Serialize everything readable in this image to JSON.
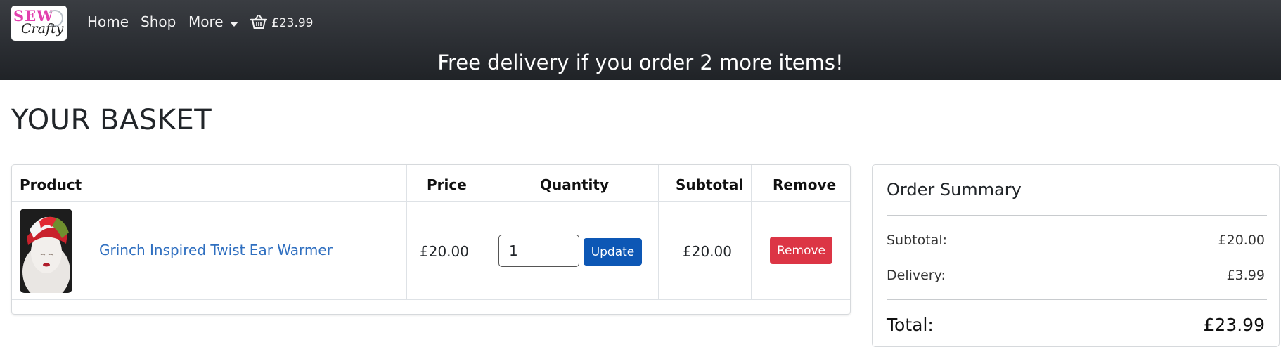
{
  "navbar": {
    "logo_text_top": "SEW",
    "logo_text_bottom": "Crafty",
    "links": [
      "Home",
      "Shop",
      "More"
    ],
    "basket_total": "£23.99",
    "promo": "Free delivery if you order 2 more items!"
  },
  "page": {
    "title": "YOUR BASKET"
  },
  "basket": {
    "headers": {
      "product": "Product",
      "price": "Price",
      "quantity": "Quantity",
      "subtotal": "Subtotal",
      "remove": "Remove"
    },
    "items": [
      {
        "name": "Grinch Inspired Twist Ear Warmer",
        "price": "£20.00",
        "quantity": "1",
        "subtotal": "£20.00",
        "update_label": "Update",
        "remove_label": "Remove"
      }
    ]
  },
  "summary": {
    "title": "Order Summary",
    "subtotal_label": "Subtotal:",
    "subtotal_value": "£20.00",
    "delivery_label": "Delivery:",
    "delivery_value": "£3.99",
    "total_label": "Total:",
    "total_value": "£23.99"
  },
  "colors": {
    "navbar": "#2b2e33",
    "link": "#2f6fc0",
    "update_button": "#0d57b5",
    "remove_button": "#dc3545",
    "logo_pink": "#e23fae"
  },
  "icons": {
    "basket": "shopping-basket-icon",
    "caret": "chevron-down-icon"
  }
}
